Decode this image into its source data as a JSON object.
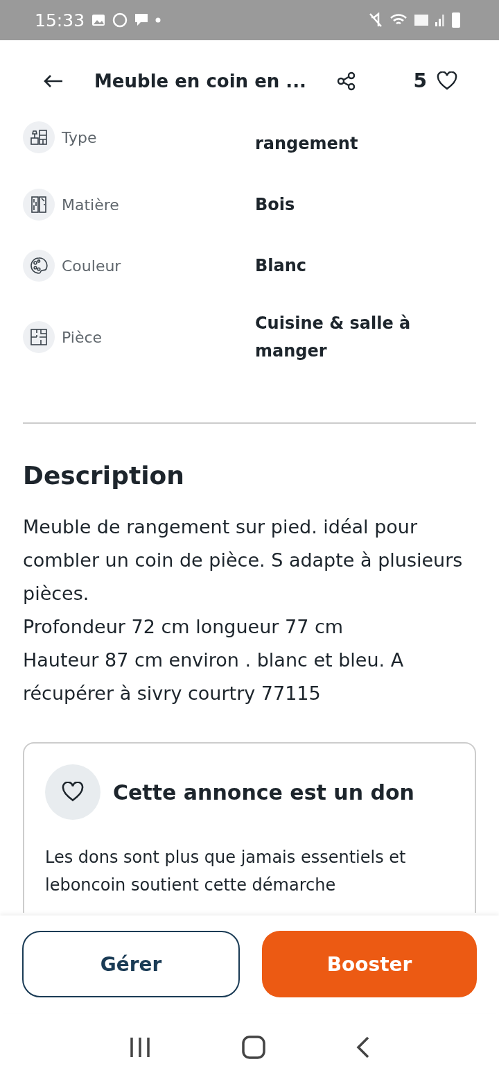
{
  "status_bar": {
    "time": "15:33"
  },
  "header": {
    "title": "Meuble en coin en ...",
    "favorites_count": "5"
  },
  "details": [
    {
      "kind": "type",
      "label": "Type",
      "value": "rangement"
    },
    {
      "kind": "material",
      "label": "Matière",
      "value": "Bois"
    },
    {
      "kind": "color",
      "label": "Couleur",
      "value": "Blanc"
    },
    {
      "kind": "room",
      "label": "Pièce",
      "value": "Cuisine & salle à manger"
    }
  ],
  "description": {
    "heading": "Description",
    "lines": [
      "Meuble de rangement sur pied. idéal pour combler un coin de pièce. S adapte à plusieurs pièces.",
      "Profondeur 72 cm longueur 77 cm",
      "Hauteur 87 cm environ . blanc et bleu. A récupérer à sivry courtry 77115"
    ]
  },
  "donation_card": {
    "title": "Cette annonce est un don",
    "text": "Les dons sont plus que jamais essentiels et leboncoin soutient cette démarche"
  },
  "buttons": [
    {
      "kind": "secondary",
      "label": "Gérer"
    },
    {
      "kind": "primary",
      "label": "Booster"
    }
  ]
}
